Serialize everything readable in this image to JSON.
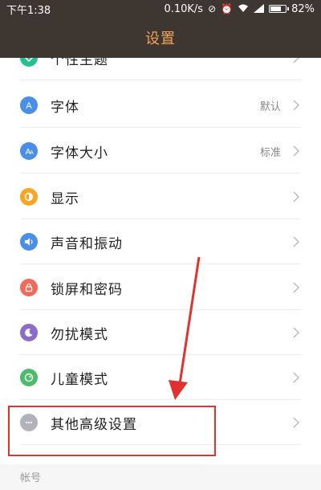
{
  "status_bar": {
    "time": "下午1:38",
    "network_speed": "0.10K/s",
    "battery": "82%",
    "battery_level": 0.82,
    "icons": [
      "alarm-off-icon",
      "alarm-icon",
      "wifi-icon",
      "signal-icon",
      "battery-icon"
    ]
  },
  "title_bar": {
    "title": "设置"
  },
  "settings": [
    {
      "label": "个性主题",
      "value": "",
      "icon": "theme-icon",
      "color": "#22c38e"
    },
    {
      "label": "字体",
      "value": "默认",
      "icon": "font-icon",
      "color": "#4a8fe7"
    },
    {
      "label": "字体大小",
      "value": "标准",
      "icon": "font-size-icon",
      "color": "#4a8fe7"
    },
    {
      "label": "显示",
      "value": "",
      "icon": "display-icon",
      "color": "#f5a623"
    },
    {
      "label": "声音和振动",
      "value": "",
      "icon": "sound-icon",
      "color": "#4a8fe7"
    },
    {
      "label": "锁屏和密码",
      "value": "",
      "icon": "lock-icon",
      "color": "#f06b5a"
    },
    {
      "label": "勿扰模式",
      "value": "",
      "icon": "moon-icon",
      "color": "#8b6cc9"
    },
    {
      "label": "儿童模式",
      "value": "",
      "icon": "kid-icon",
      "color": "#4cbb6a"
    },
    {
      "label": "其他高级设置",
      "value": "",
      "icon": "more-icon",
      "color": "#b0b4ba"
    }
  ],
  "section": {
    "label": "帐号"
  },
  "annotation": {
    "highlight_color": "#e0322e"
  }
}
